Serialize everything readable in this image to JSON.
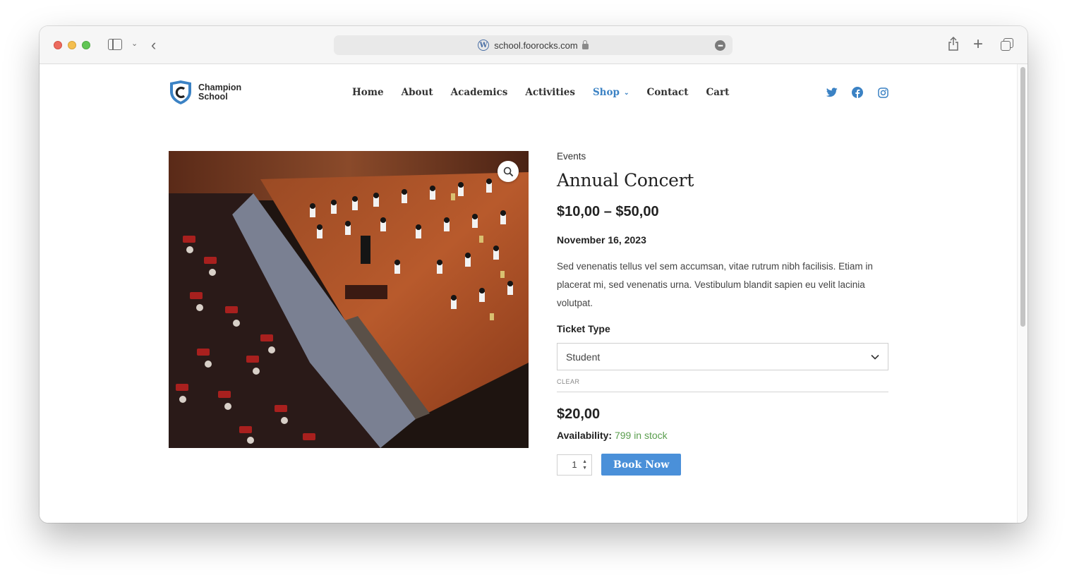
{
  "browser": {
    "url": "school.foorocks.com"
  },
  "site": {
    "logo_line1": "Champion",
    "logo_line2": "School"
  },
  "nav": {
    "items": [
      {
        "label": "Home"
      },
      {
        "label": "About"
      },
      {
        "label": "Academics"
      },
      {
        "label": "Activities"
      },
      {
        "label": "Shop",
        "active": true
      },
      {
        "label": "Contact"
      },
      {
        "label": "Cart"
      }
    ]
  },
  "social": [
    "twitter-icon",
    "facebook-icon",
    "instagram-icon"
  ],
  "product": {
    "category": "Events",
    "title": "Annual Concert",
    "price_range": "$10,00 – $50,00",
    "date": "November 16, 2023",
    "description": "Sed venenatis tellus vel sem accumsan, vitae rutrum nibh facilisis. Etiam in placerat mi, sed venenatis urna. Vestibulum blandit sapien eu velit lacinia volutpat.",
    "ticket_label": "Ticket Type",
    "ticket_selected": "Student",
    "clear_label": "CLEAR",
    "price": "$20,00",
    "availability_label": "Availability:",
    "stock": "799 in stock",
    "quantity": "1",
    "book_label": "Book Now"
  },
  "colors": {
    "accent": "#3b82c4",
    "button": "#4a90d9",
    "stock": "#5a9e4e"
  }
}
